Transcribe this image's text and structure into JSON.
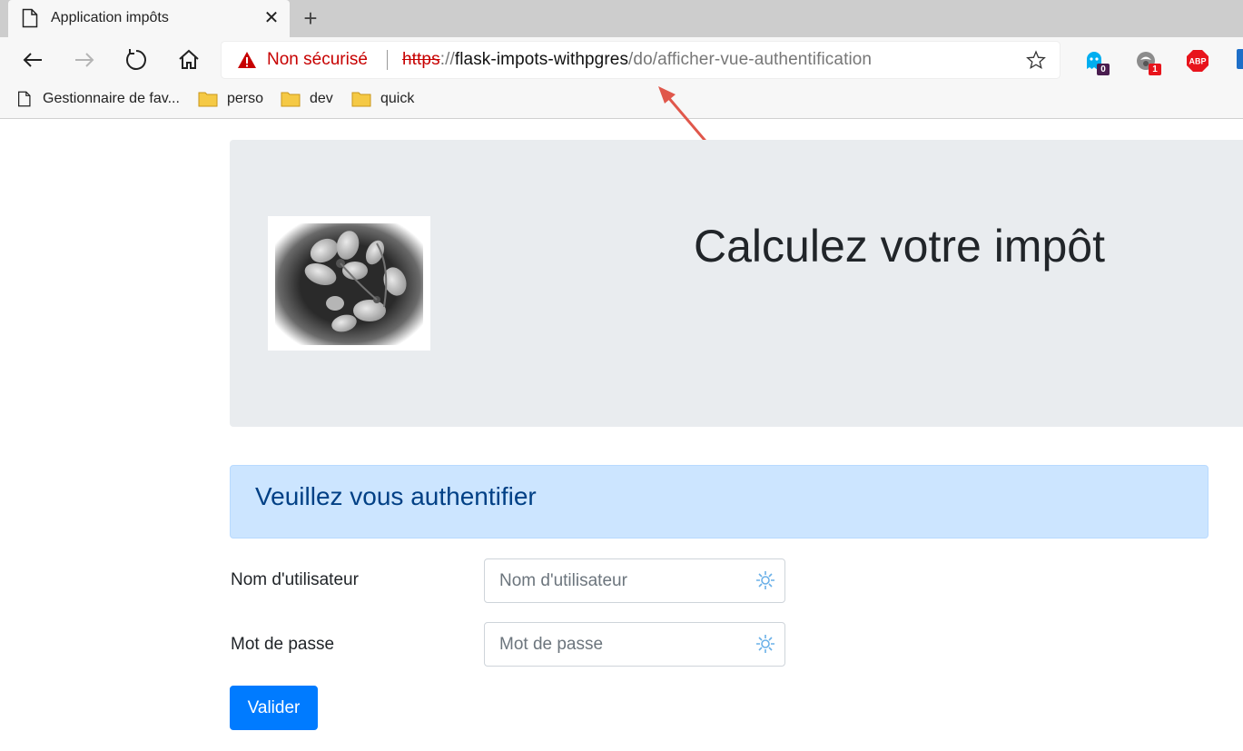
{
  "browser": {
    "tab_title": "Application impôts",
    "new_tab_icon": "plus-icon",
    "address": {
      "security_label": "Non sécurisé",
      "url_scheme": "https",
      "url_scheme_sep": "://",
      "url_host": "flask-impots-withpgres",
      "url_path": "/do/afficher-vue-authentification"
    },
    "extensions": [
      {
        "name": "ghostery-icon",
        "badge": "0",
        "badge_color": "#4a1d4f"
      },
      {
        "name": "privacy-badger-icon",
        "badge": "1",
        "badge_color": "#e8141c"
      },
      {
        "name": "adblock-plus-icon",
        "label": "ABP",
        "color": "#e8141c"
      }
    ],
    "bookmarks": [
      {
        "label": "Gestionnaire de fav...",
        "icon": "page-icon"
      },
      {
        "label": "perso",
        "icon": "folder-icon"
      },
      {
        "label": "dev",
        "icon": "folder-icon"
      },
      {
        "label": "quick",
        "icon": "folder-icon"
      }
    ]
  },
  "page": {
    "hero_title": "Calculez votre impôt",
    "alert_title": "Veuillez vous authentifier",
    "form": {
      "username_label": "Nom d'utilisateur",
      "username_placeholder": "Nom d'utilisateur",
      "password_label": "Mot de passe",
      "password_placeholder": "Mot de passe",
      "submit_label": "Valider"
    }
  },
  "colors": {
    "primary": "#007bff",
    "alert_bg": "#cce5ff",
    "alert_text": "#004085",
    "jumbotron_bg": "#e9ecef",
    "insecure_red": "#c70000",
    "annotation_arrow": "#e0574b"
  }
}
